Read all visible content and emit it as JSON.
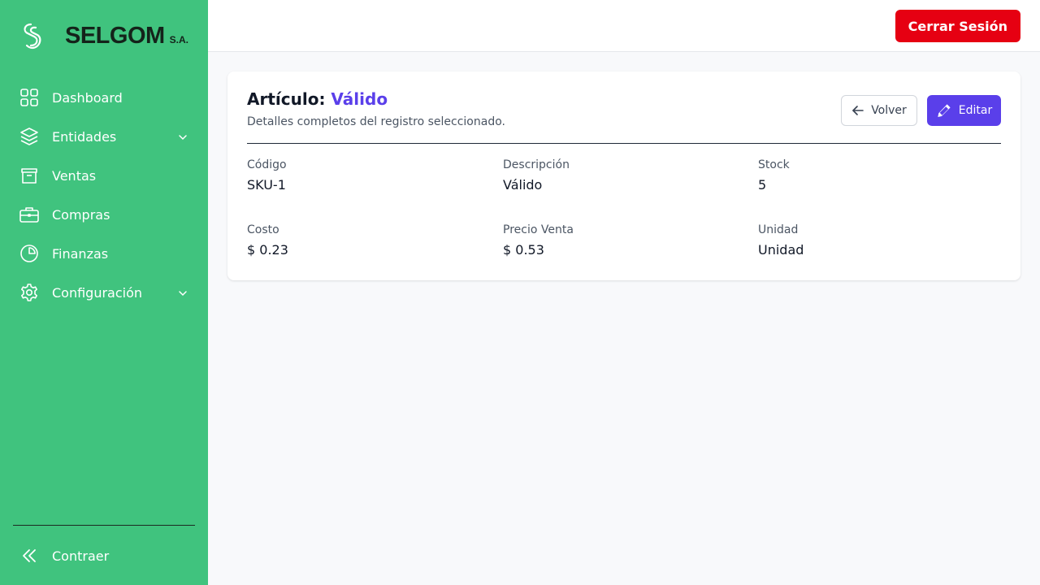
{
  "brand": {
    "name": "SELGOM",
    "suffix": "S.A."
  },
  "sidebar": {
    "items": [
      {
        "label": "Dashboard",
        "icon": "grid-icon"
      },
      {
        "label": "Entidades",
        "icon": "layers-icon",
        "expandable": true
      },
      {
        "label": "Ventas",
        "icon": "archive-box-icon"
      },
      {
        "label": "Compras",
        "icon": "briefcase-icon"
      },
      {
        "label": "Finanzas",
        "icon": "pie-chart-icon"
      },
      {
        "label": "Configuración",
        "icon": "gear-icon",
        "expandable": true
      }
    ],
    "collapse_label": "Contraer"
  },
  "header": {
    "logout_label": "Cerrar Sesión"
  },
  "detail": {
    "title_prefix": "Artículo:",
    "title_value": "Válido",
    "subtitle": "Detalles completos del registro seleccionado.",
    "back_label": "Volver",
    "edit_label": "Editar",
    "fields": [
      {
        "label": "Código",
        "value": "SKU-1"
      },
      {
        "label": "Descripción",
        "value": "Válido"
      },
      {
        "label": "Stock",
        "value": "5"
      },
      {
        "label": "Costo",
        "value": "$ 0.23"
      },
      {
        "label": "Precio Venta",
        "value": "$ 0.53"
      },
      {
        "label": "Unidad",
        "value": "Unidad"
      }
    ]
  },
  "colors": {
    "sidebar_bg": "#40c37e",
    "accent": "#5a3fea",
    "logout_bg": "#e60012",
    "page_bg": "#f8f9fb"
  }
}
